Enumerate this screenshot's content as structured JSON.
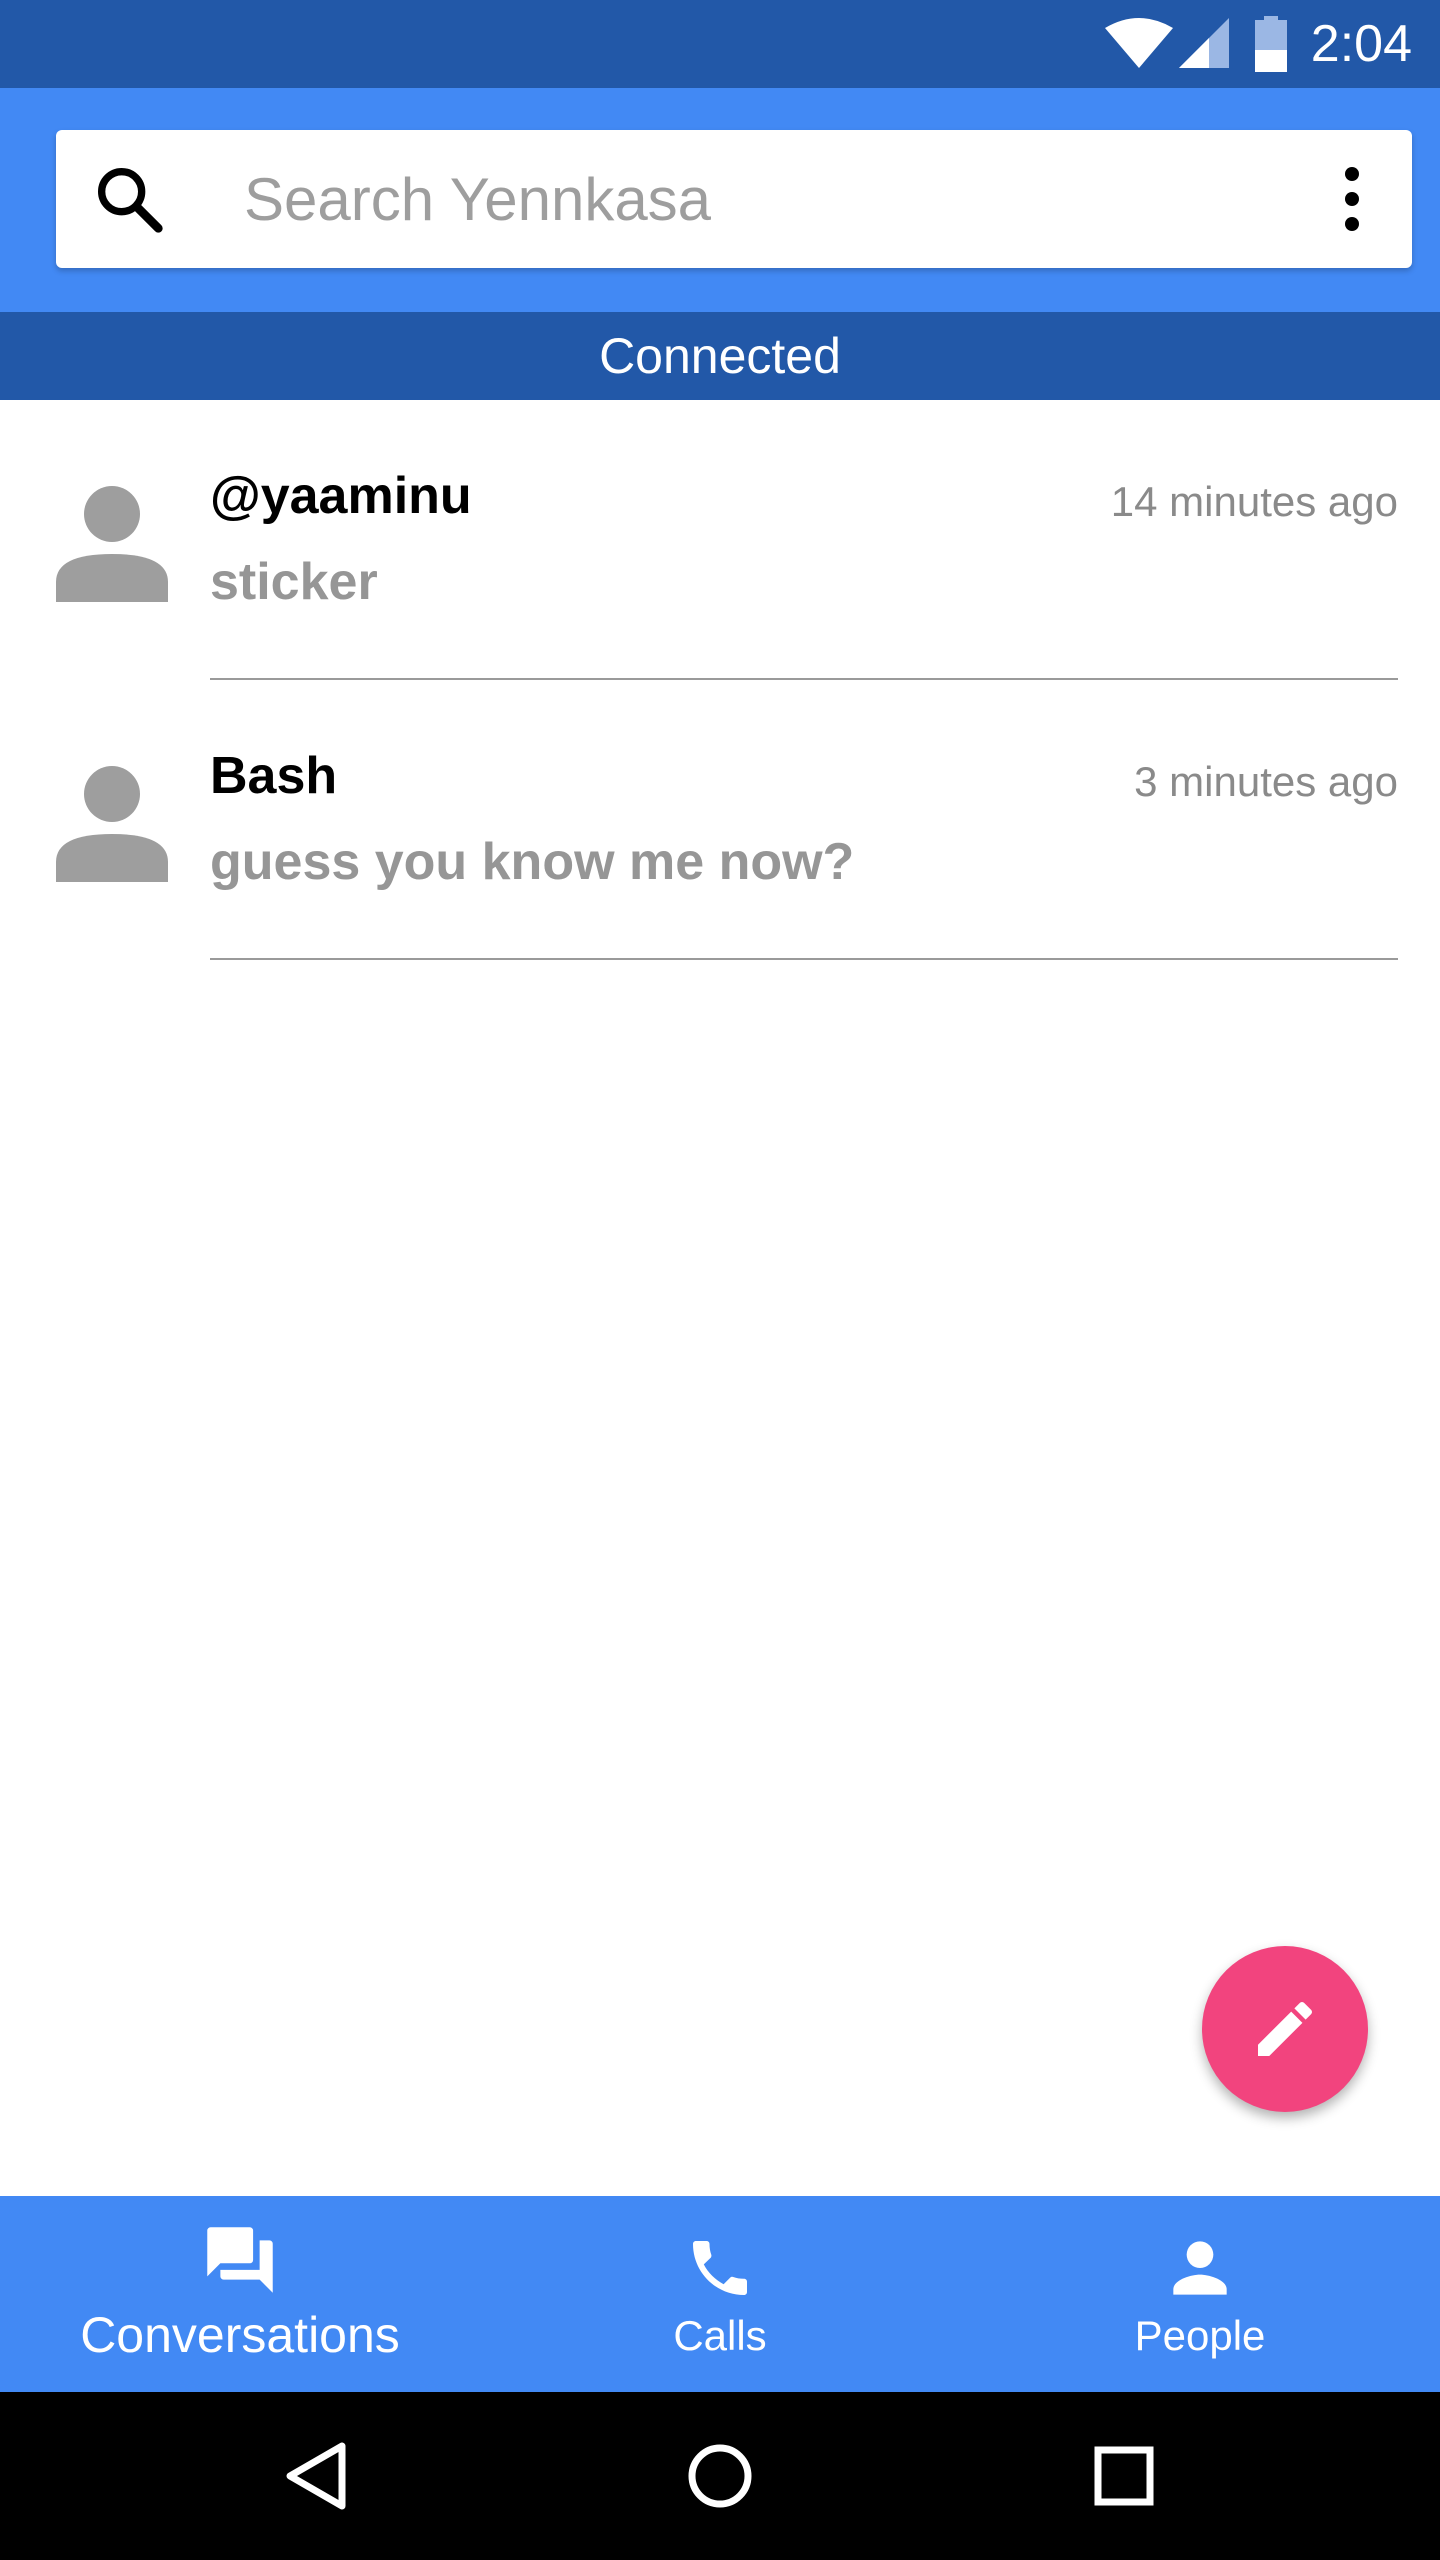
{
  "status_bar": {
    "time": "2:04",
    "icons": [
      "wifi-icon",
      "cellular-signal-icon",
      "battery-icon"
    ]
  },
  "search": {
    "placeholder": "Search Yennkasa",
    "value": ""
  },
  "connection_status": "Connected",
  "conversations": [
    {
      "name": "@yaaminu",
      "preview": "sticker",
      "time": "14 minutes ago"
    },
    {
      "name": "Bash",
      "preview": "guess you know me now?",
      "time": "3 minutes ago"
    }
  ],
  "fab": {
    "icon": "pencil-icon"
  },
  "bottom_nav": {
    "tabs": [
      {
        "label": "Conversations",
        "icon": "chat-bubbles-icon",
        "selected": true
      },
      {
        "label": "Calls",
        "icon": "phone-icon",
        "selected": false
      },
      {
        "label": "People",
        "icon": "person-icon",
        "selected": false
      }
    ]
  },
  "system_nav": [
    "back-icon",
    "home-icon",
    "recents-icon"
  ],
  "colors": {
    "primary": "#4289f4",
    "primary_dark": "#2258a8",
    "accent": "#f2447e",
    "secondary_text": "#969696"
  }
}
